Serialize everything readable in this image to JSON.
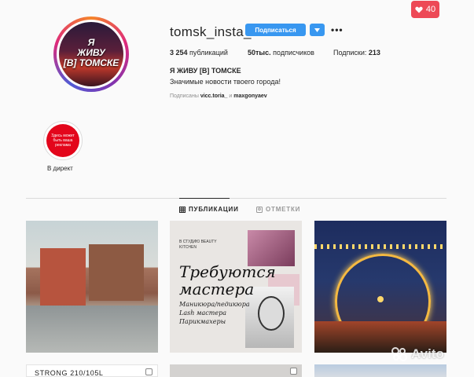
{
  "notifications": {
    "icon": "heart-icon",
    "count": "40",
    "color": "#ed4956"
  },
  "profile": {
    "avatar_text_line1": "Я",
    "avatar_text_line2": "ЖИВУ",
    "avatar_text_line3": "[В] ТОМСКЕ",
    "username": "tomsk_insta_",
    "follow_label": "Подписаться",
    "more_icon": "more-horizontal-icon",
    "posts_count": "3 254",
    "posts_label": "публикаций",
    "followers_count": "50тыс.",
    "followers_label": "подписчиков",
    "following_label": "Подписки:",
    "following_count": "213",
    "full_name": "Я ЖИВУ [В] ТОМСКЕ",
    "bio": "Значимые новости твоего города!",
    "followed_by_prefix": "Подписаны",
    "followed_by_user1": "vicc.toria_",
    "followed_by_and": "и",
    "followed_by_user2": "maxgonyaev"
  },
  "highlights": [
    {
      "thumb_text": "Здесь может быть ваша реклама",
      "label": "В директ"
    }
  ],
  "tabs": [
    {
      "label": "ПУБЛИКАЦИИ",
      "icon": "grid-icon",
      "active": true
    },
    {
      "label": "ОТМЕТКИ",
      "icon": "tagged-icon",
      "active": false
    }
  ],
  "posts": {
    "p2": {
      "small_text": "В СТУДИЮ BEAUTY KITCHEN",
      "headline": "Требуются мастера",
      "lines": [
        "Маникюра/педикюра",
        "Lash мастера",
        "Парикмахеры"
      ]
    },
    "p4": {
      "text": "STRONG 210/105L"
    }
  },
  "watermark": {
    "text": "Avito"
  },
  "colors": {
    "accent": "#3897f0",
    "text": "#262626",
    "muted": "#8e8e8e",
    "background": "#fafafa"
  }
}
